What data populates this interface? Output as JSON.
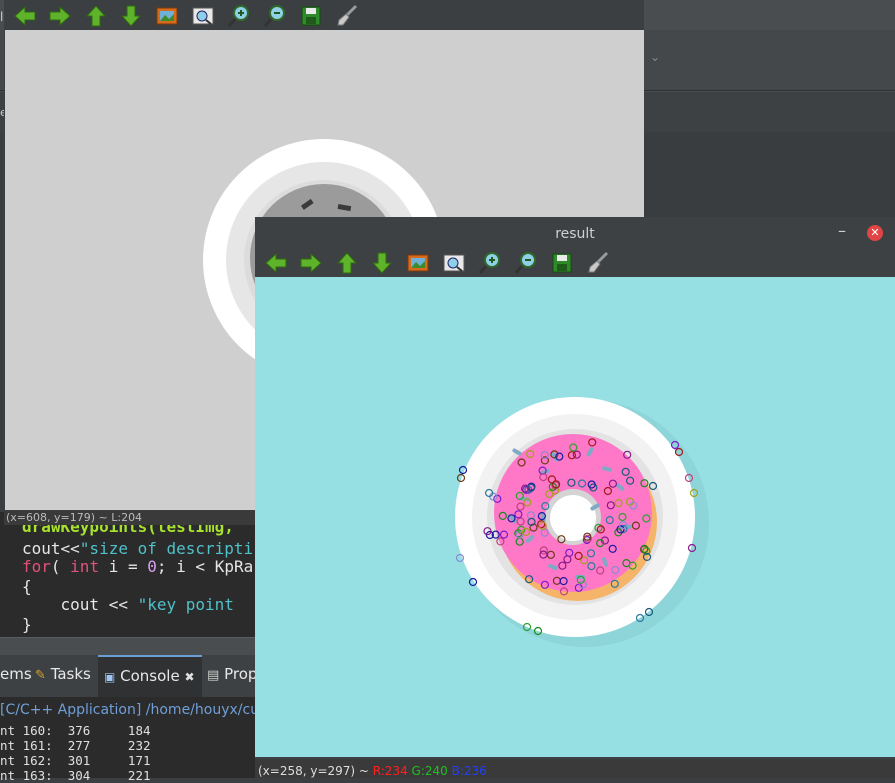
{
  "ide": {
    "code_lines": {
      "line1": "drawKeypoints(testImg, ",
      "line2_a": "cout<<",
      "line2_b": "\"size of descripti",
      "line3_a": "for",
      "line3_b": "( ",
      "line3_c": "int",
      "line3_d": " i = ",
      "line3_e": "0",
      "line3_f": "; i < KpRa",
      "line4": "{",
      "line5_a": "    cout << ",
      "line5_b": "\"key point ",
      "line6": "}"
    },
    "tabs": {
      "problems": "ems",
      "tasks": "Tasks",
      "console": "Console",
      "properties": "Prop"
    },
    "console": {
      "header": "[C/C++ Application] /home/houyx/cud",
      "rows": [
        "nt 160:  376     184",
        "nt 161:  277     232",
        "nt 162:  301     171",
        "nt 163:  304     221"
      ]
    }
  },
  "window1": {
    "status": "(x=608, y=179) ~ L:204",
    "toolbar_icons": [
      "arrow-left-icon",
      "arrow-right-icon",
      "arrow-up-icon",
      "arrow-down-icon",
      "image-icon",
      "zoom-window-icon",
      "zoom-in-icon",
      "zoom-out-icon",
      "save-icon",
      "brush-icon"
    ]
  },
  "window2": {
    "title": "result",
    "minimize_label": "–",
    "status_coords": "(x=258, y=297) ~ ",
    "status_r": "R:234",
    "status_g": "G:240",
    "status_b": "B:236",
    "colors": {
      "r": "#ff2020",
      "g": "#20c020",
      "b": "#2040ff"
    }
  }
}
